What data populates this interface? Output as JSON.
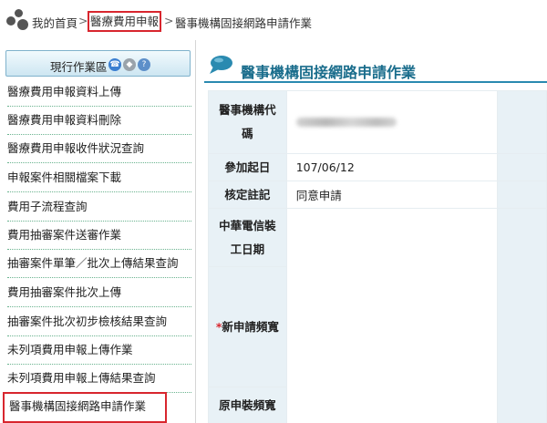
{
  "breadcrumb": {
    "home_label": "我的首頁",
    "sep1": ">",
    "section_label": "醫療費用申報",
    "sep2": ">",
    "current_label": "醫事機構固接網路申請作業"
  },
  "sidebar": {
    "header_title": "現行作業區",
    "header_icons": [
      "phone-icon",
      "tag-icon",
      "help-icon"
    ],
    "items": [
      {
        "label": "醫療費用申報資料上傳"
      },
      {
        "label": "醫療費用申報資料刪除"
      },
      {
        "label": "醫療費用申報收件狀況查詢"
      },
      {
        "label": "申報案件相關檔案下載"
      },
      {
        "label": "費用子流程查詢"
      },
      {
        "label": "費用抽審案件送審作業"
      },
      {
        "label": "抽審案件單筆／批次上傳結果查詢"
      },
      {
        "label": "費用抽審案件批次上傳"
      },
      {
        "label": "抽審案件批次初步檢核結果查詢"
      },
      {
        "label": "未列項費用申報上傳作業"
      },
      {
        "label": "未列項費用申報上傳結果查詢"
      },
      {
        "label": "醫事機構固接網路申請作業"
      }
    ]
  },
  "main": {
    "title": "醫事機構固接網路申請作業",
    "rows": {
      "org_code": {
        "label_line1": "醫事機構代",
        "label_line2": "碼",
        "value": ""
      },
      "join_date": {
        "label": "參加起日",
        "value": "107/06/12"
      },
      "approval": {
        "label": "核定註記",
        "value": "同意申請"
      },
      "install_date": {
        "label_line1": "中華電信裝",
        "label_line2": "工日期",
        "value": ""
      },
      "new_bandwidth": {
        "required_mark": "*",
        "label": "新申請頻寬",
        "value": ""
      },
      "orig_bandwidth": {
        "label": "原申裝頻寬",
        "value": ""
      }
    }
  },
  "colors": {
    "accent": "#1a6d8c",
    "highlight_border": "#d8262e",
    "label_bg": "#e8f1f6",
    "menu_divider": "#6ab38f"
  }
}
